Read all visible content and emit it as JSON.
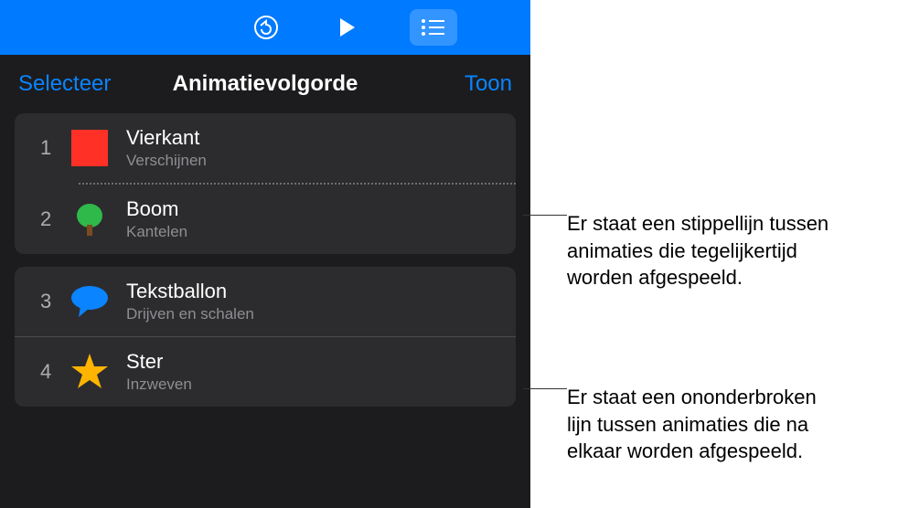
{
  "toolbar": {
    "undo_icon": "undo",
    "play_icon": "play",
    "list_icon": "list"
  },
  "header": {
    "select": "Selecteer",
    "title": "Animatievolgorde",
    "show": "Toon"
  },
  "groups": [
    {
      "rows": [
        {
          "num": "1",
          "name": "Vierkant",
          "effect": "Verschijnen"
        },
        {
          "num": "2",
          "name": "Boom",
          "effect": "Kantelen"
        }
      ],
      "divider": "dotted"
    },
    {
      "rows": [
        {
          "num": "3",
          "name": "Tekstballon",
          "effect": "Drijven en schalen"
        },
        {
          "num": "4",
          "name": "Ster",
          "effect": "Inzweven"
        }
      ],
      "divider": "solid"
    }
  ],
  "callouts": {
    "dotted": "Er staat een stippellijn tussen animaties die tegelijkertijd worden afgespeeld.",
    "solid": "Er staat een ononderbroken lijn tussen animaties die na elkaar worden afgespeeld."
  }
}
